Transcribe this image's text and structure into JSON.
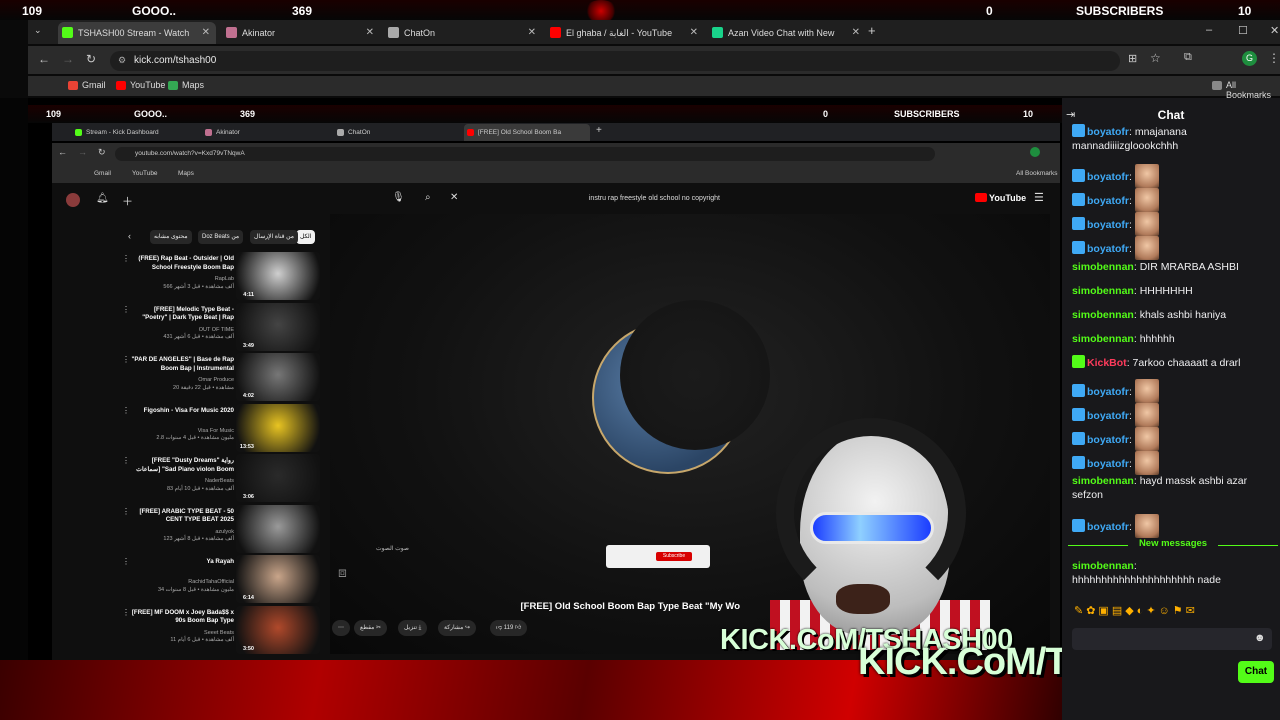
{
  "overlay_top": {
    "left_count": "109",
    "goal_label": "GOOO..",
    "goal_count": "369",
    "mid_count": "0",
    "subs_label": "SUBSCRIBERS",
    "subs_count": "10"
  },
  "outer_tabs": [
    {
      "label": "TSHASH00 Stream - Watch",
      "color": "#53fc18"
    },
    {
      "label": "Akinator",
      "color": "#c07090"
    },
    {
      "label": "ChatOn",
      "color": "#aaaaaa"
    },
    {
      "label": "El ghaba / الغابة - YouTube",
      "color": "#ff0000"
    },
    {
      "label": "Azan Video Chat with New",
      "color": "#19d38a"
    }
  ],
  "outer_url": "kick.com/tshash00",
  "outer_bookmarks": [
    "Gmail",
    "YouTube",
    "Maps"
  ],
  "all_bookmarks": "All Bookmarks",
  "inner_tabs": [
    {
      "label": "Stream - Kick Dashboard",
      "color": "#53fc18"
    },
    {
      "label": "Akinator",
      "color": "#c07090"
    },
    {
      "label": "ChatOn",
      "color": "#aaaaaa"
    },
    {
      "label": "[FREE] Old School Boom Ba",
      "color": "#ff0000"
    }
  ],
  "inner_url": "youtube.com/watch?v=Kxd79vTNqwA",
  "inner_bookmarks": [
    "Gmail",
    "YouTube",
    "Maps"
  ],
  "inner_all_bookmarks": "All Bookmarks",
  "yt_search_query": "instru rap freestyle old school no copyright",
  "yt_logo": "YouTube",
  "chips": [
    "الكل",
    "من قناة الإرسال",
    "Doz Beats من",
    "محتوى مشابه"
  ],
  "videos": [
    {
      "title": "(FREE) Rap Beat - Outsider | Old School Freestyle Boom Bap",
      "sub": "RapLab",
      "meta": "566 ألف مشاهدة • قبل 3 أشهر",
      "dur": "4:11",
      "color": "#cfcfcf"
    },
    {
      "title": "[FREE] Melodic Type Beat - \"Poetry\" | Dark Type Beat | Rap",
      "sub": "OUT OF TIME",
      "meta": "431 ألف مشاهدة • قبل 6 أشهر",
      "dur": "3:49",
      "color": "#444444"
    },
    {
      "title": "\"PAR DE ANGELES\" | Base de Rap Boom Bap | Instrumental",
      "sub": "Omar Produce",
      "meta": "20 مشاهدة • قبل 22 دقيقة",
      "dur": "4:02",
      "color": "#777777"
    },
    {
      "title": "Figoshin - Visa For Music 2020",
      "sub": "Visa For Music",
      "meta": "2.8 مليون مشاهدة • قبل 4 سنوات",
      "dur": "13:53",
      "color": "#e8c422"
    },
    {
      "title": "[FREE \"Dusty Dreams\" رواية سماعات] \"Sad Piano violon Boom",
      "sub": "NaderBeats",
      "meta": "83 ألف مشاهدة • قبل 10 أيام",
      "dur": "3:06",
      "color": "#2a2a2a"
    },
    {
      "title": "[FREE] ARABIC TYPE BEAT - 50 CENT TYPE BEAT 2025",
      "sub": "azulyok",
      "meta": "123 ألف مشاهدة • قبل 8 أشهر",
      "dur": "",
      "color": "#9a9a9a"
    },
    {
      "title": "Ya Rayah",
      "sub": "RachidTahaOfficial",
      "meta": "34 مليون مشاهدة • قبل 8 سنوات",
      "dur": "6:14",
      "color": "#c9a58a"
    },
    {
      "title": "[FREE] MF DOOM x Joey Bada$$ x 90s Boom Bap Type",
      "sub": "Seeet Beats",
      "meta": "11 ألف مشاهدة • قبل 6 أيام",
      "dur": "3:50",
      "color": "#b0492b"
    }
  ],
  "video_title": "[FREE] Old School Boom Bap Type Beat \"My Wo",
  "subscribe_label": "Subscribe",
  "actions": {
    "likes": "119",
    "share": "مشاركة",
    "download": "تنزيل",
    "clip": "مقطع"
  },
  "mute_hint": "صوت الصوت",
  "kick_watermark": "KICK.CoM/TSHASH00",
  "chat": {
    "title": "Chat",
    "messages": [
      {
        "user": "boyatofr",
        "text": "mnajanana mannadiiiizgloookchhh",
        "emote": false,
        "badge": true,
        "color": "bt"
      },
      {
        "user": "boyatofr",
        "text": "",
        "emote": true,
        "badge": true,
        "color": "bt"
      },
      {
        "user": "boyatofr",
        "text": "",
        "emote": true,
        "badge": true,
        "color": "bt"
      },
      {
        "user": "boyatofr",
        "text": "",
        "emote": true,
        "badge": true,
        "color": "bt"
      },
      {
        "user": "boyatofr",
        "text": "",
        "emote": true,
        "badge": true,
        "color": "bt"
      },
      {
        "user": "simobennan",
        "text": "DIR MRARBA ASHBI",
        "emote": false,
        "badge": false,
        "color": "g"
      },
      {
        "user": "simobennan",
        "text": "HHHHHHH",
        "emote": false,
        "badge": false,
        "color": "g"
      },
      {
        "user": "simobennan",
        "text": "khals ashbi haniya",
        "emote": false,
        "badge": false,
        "color": "g"
      },
      {
        "user": "simobennan",
        "text": "hhhhhh",
        "emote": false,
        "badge": false,
        "color": "g"
      },
      {
        "user": "KickBot",
        "text": "7arkoo chaaaatt a drarl",
        "emote": false,
        "badge": true,
        "color": "r"
      },
      {
        "user": "boyatofr",
        "text": "",
        "emote": true,
        "badge": true,
        "color": "bt"
      },
      {
        "user": "boyatofr",
        "text": "",
        "emote": true,
        "badge": true,
        "color": "bt"
      },
      {
        "user": "boyatofr",
        "text": "",
        "emote": true,
        "badge": true,
        "color": "bt"
      },
      {
        "user": "boyatofr",
        "text": "",
        "emote": true,
        "badge": true,
        "color": "bt"
      },
      {
        "user": "simobennan",
        "text": "hayd massk ashbi azar sefzon",
        "emote": false,
        "badge": false,
        "color": "g"
      },
      {
        "user": "boyatofr",
        "text": "",
        "emote": true,
        "badge": true,
        "color": "bt"
      }
    ],
    "new_messages": "New messages",
    "last_user": "simobennan",
    "last_text": "hhhhhhhhhhhhhhhhhhhhh nade",
    "send_label": "Chat"
  }
}
